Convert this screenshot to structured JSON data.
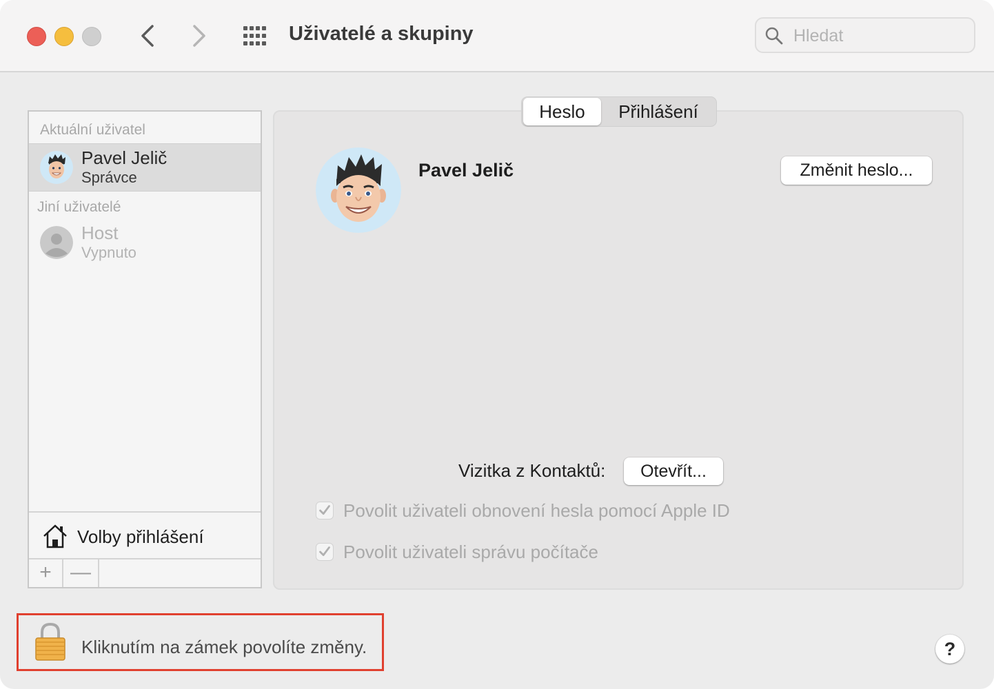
{
  "window": {
    "title": "Uživatelé a skupiny"
  },
  "search": {
    "placeholder": "Hledat"
  },
  "sidebar": {
    "current_section": "Aktuální uživatel",
    "other_section": "Jiní uživatelé",
    "current_user": {
      "name": "Pavel Jelič",
      "role": "Správce"
    },
    "other_users": [
      {
        "name": "Host",
        "role": "Vypnuto"
      }
    ],
    "login_options": "Volby přihlášení",
    "add_symbol": "+",
    "remove_symbol": "—"
  },
  "tabs": {
    "items": [
      {
        "label": "Heslo",
        "active": true
      },
      {
        "label": "Přihlášení",
        "active": false
      }
    ]
  },
  "detail": {
    "full_name": "Pavel Jelič",
    "change_password": "Změnit heslo...",
    "contact_card_label": "Vizitka z Kontaktů:",
    "open_button": "Otevřít...",
    "checkboxes": [
      {
        "label": "Povolit uživateli obnovení hesla pomocí Apple ID",
        "checked": true,
        "enabled": false
      },
      {
        "label": "Povolit uživateli správu počítače",
        "checked": true,
        "enabled": false
      }
    ]
  },
  "footer": {
    "lock_text": "Kliknutím na zámek povolíte změny.",
    "help_label": "?"
  },
  "colors": {
    "close": "#ec5f57",
    "minimize": "#f5be3e",
    "zoom": "#cfcfcf",
    "highlight": "#e0402f",
    "avatar_bg": "#cfe8f7"
  },
  "icons": [
    "back-chevron-icon",
    "forward-chevron-icon",
    "grid-icon",
    "search-icon",
    "home-icon",
    "lock-icon",
    "avatar-memoji",
    "guest-avatar-icon",
    "checkmark-icon"
  ]
}
